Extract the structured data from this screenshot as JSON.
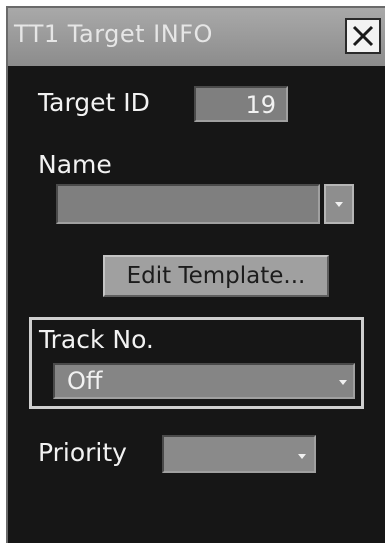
{
  "window": {
    "title": "TT1 Target INFO",
    "close_icon": "close-x-icon"
  },
  "target_id": {
    "label": "Target ID",
    "value": "19"
  },
  "name": {
    "label": "Name",
    "value": "",
    "dropdown_icon": "chevron-down-icon"
  },
  "edit_template": {
    "label": "Edit Template..."
  },
  "track_no": {
    "label": "Track No.",
    "value": "Off",
    "dropdown_icon": "chevron-down-icon"
  },
  "priority": {
    "label": "Priority",
    "value": "",
    "dropdown_icon": "chevron-down-icon"
  },
  "colors": {
    "panel_background": "#161616",
    "title_bar": "#9a9a9a",
    "field_background": "#7f7f7f",
    "text": "#f2f2f2"
  }
}
